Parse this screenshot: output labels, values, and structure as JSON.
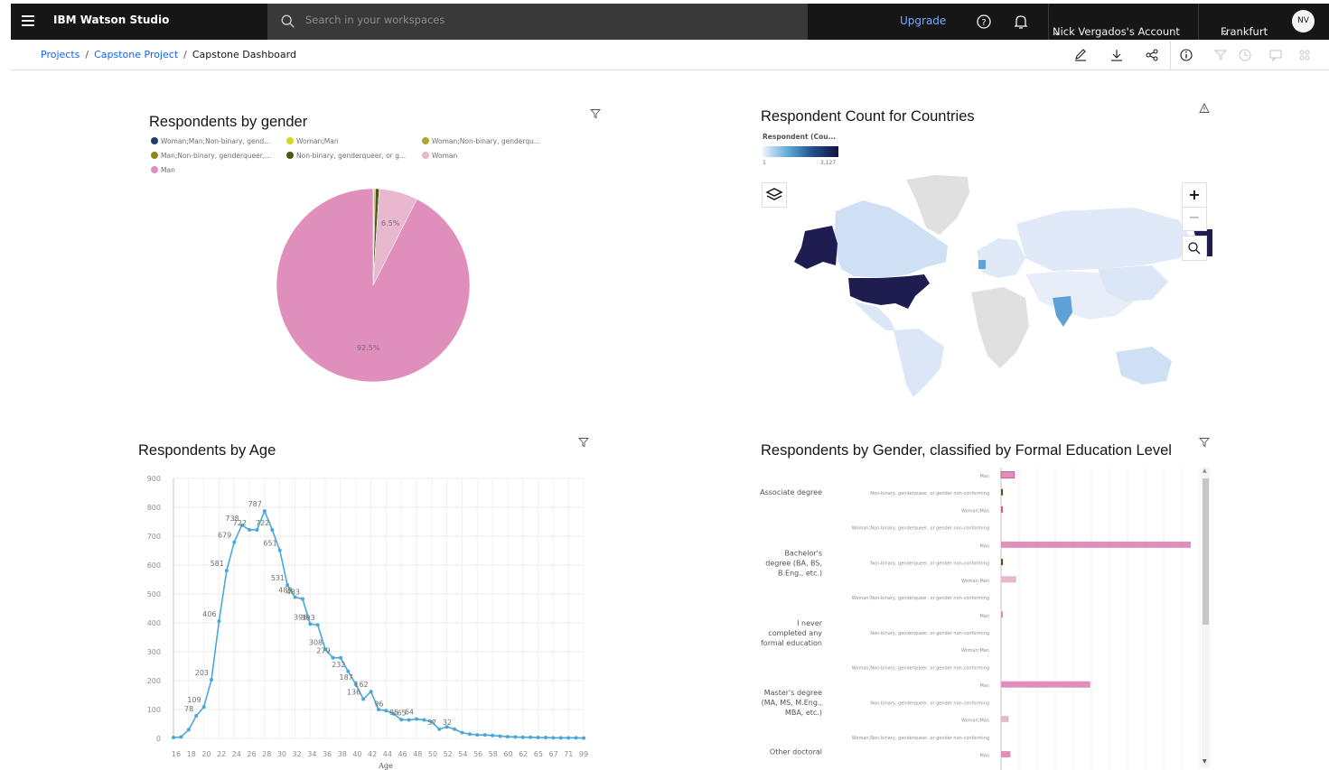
{
  "header": {
    "app_name": "IBM Watson Studio",
    "search_placeholder": "Search in your workspaces",
    "upgrade_label": "Upgrade",
    "account_label": "Nick Vergados's Account",
    "region_label": "Frankfurt",
    "avatar_initials": "NV"
  },
  "breadcrumb": {
    "items": [
      "Projects",
      "Capstone Project"
    ],
    "current": "Capstone Dashboard",
    "separator": "/"
  },
  "cards": {
    "gender": {
      "title": "Respondents by gender",
      "legend": [
        {
          "label": "Woman;Man;Non-binary, gend...",
          "color": "#1f3b73"
        },
        {
          "label": "Woman;Man",
          "color": "#d6d61f"
        },
        {
          "label": "Woman;Non-binary, genderqu...",
          "color": "#a8a832"
        },
        {
          "label": "Man;Non-binary, genderqueer,...",
          "color": "#8a8a1c"
        },
        {
          "label": "Non-binary, genderqueer, or g...",
          "color": "#4a5a12"
        },
        {
          "label": "Woman",
          "color": "#e8b8cf"
        },
        {
          "label": "Man",
          "color": "#e08fbd"
        }
      ],
      "slice_labels": {
        "man": "92.5%",
        "woman": "6.5%"
      }
    },
    "countries": {
      "title": "Respondent Count for Countries",
      "legend_title": "Respondent (Cou...",
      "legend_min": "1",
      "legend_max": "3,127"
    },
    "age": {
      "title": "Respondents by Age",
      "xlabel": "Age"
    },
    "education": {
      "title": "Respondents by Gender, classified by Formal Education Level",
      "groups": [
        {
          "label": "Associate degree",
          "rows": [
            "Man",
            "Non-binary, genderqueer, or gender non-conforming",
            "Woman;Man",
            "Woman;Non-binary, genderqueer, or gender non-conforming"
          ]
        },
        {
          "label": "Bachelor's degree (BA, BS, B.Eng., etc.)",
          "rows": [
            "Man",
            "Non-binary, genderqueer, or gender non-conforming",
            "Woman;Man",
            "Woman;Non-binary, genderqueer, or gender non-conforming"
          ]
        },
        {
          "label": "I never completed any formal education",
          "rows": [
            "Man",
            "Non-binary, genderqueer, or gender non-conforming",
            "Woman;Man",
            "Woman;Non-binary, genderqueer, or gender non-conforming"
          ]
        },
        {
          "label": "Master's degree (MA, MS, M.Eng., MBA, etc.)",
          "rows": [
            "Man",
            "Non-binary, genderqueer, or gender non-conforming",
            "Woman;Man",
            "Woman;Non-binary, genderqueer, or gender non-conforming"
          ]
        },
        {
          "label": "Other doctoral",
          "rows": [
            "Man"
          ]
        }
      ]
    }
  },
  "colors": {
    "man": "#e08fbd",
    "woman": "#e8b8cf",
    "nonbinary": "#4a5a12",
    "line": "#4aa8d8",
    "map_dark": "#1f1d4f",
    "map_light": "#cfe0f4"
  },
  "chart_data": [
    {
      "type": "pie",
      "title": "Respondents by gender",
      "categories": [
        "Man",
        "Woman",
        "Non-binary, genderqueer, or g...",
        "Man;Non-binary, genderqueer,...",
        "Woman;Non-binary, genderqu...",
        "Woman;Man",
        "Woman;Man;Non-binary, gend..."
      ],
      "values": [
        92.5,
        6.5,
        0.6,
        0.2,
        0.1,
        0.05,
        0.05
      ],
      "data_labels": [
        "92.5%",
        "6.5%"
      ]
    },
    {
      "type": "line",
      "title": "Respondents by Age",
      "xlabel": "Age",
      "ylabel": "",
      "ylim": [
        0,
        900
      ],
      "yticks": [
        0,
        100,
        200,
        300,
        400,
        500,
        600,
        700,
        800,
        900
      ],
      "x": [
        16,
        17,
        18,
        19,
        20,
        21,
        22,
        23,
        24,
        25,
        26,
        27,
        28,
        29,
        30,
        31,
        32,
        33,
        34,
        35,
        36,
        37,
        38,
        39,
        40,
        41,
        42,
        43,
        44,
        45,
        46,
        47,
        48,
        49,
        50,
        51,
        52,
        53,
        54,
        55,
        56,
        57,
        58,
        59,
        60,
        61,
        62,
        63,
        65,
        66,
        67,
        69,
        71,
        72,
        99
      ],
      "values": [
        3,
        5,
        30,
        78,
        109,
        203,
        406,
        581,
        679,
        738,
        722,
        722,
        787,
        722,
        651,
        531,
        489,
        483,
        396,
        393,
        308,
        279,
        279,
        232,
        187,
        136,
        162,
        100,
        96,
        85,
        65,
        64,
        67,
        64,
        57,
        32,
        40,
        32,
        20,
        15,
        12,
        12,
        10,
        8,
        6,
        5,
        4,
        4,
        3,
        3,
        2,
        2,
        2,
        2,
        1
      ],
      "data_labels": [
        {
          "x": 19,
          "label": "78"
        },
        {
          "x": 20,
          "label": "109"
        },
        {
          "x": 21,
          "label": "203"
        },
        {
          "x": 22,
          "label": "406"
        },
        {
          "x": 23,
          "label": "581"
        },
        {
          "x": 24,
          "label": "679"
        },
        {
          "x": 25,
          "label": "738"
        },
        {
          "x": 26,
          "label": "722"
        },
        {
          "x": 28,
          "label": "787"
        },
        {
          "x": 29,
          "label": "722"
        },
        {
          "x": 30,
          "label": "651"
        },
        {
          "x": 31,
          "label": "531"
        },
        {
          "x": 32,
          "label": "489"
        },
        {
          "x": 33,
          "label": "483"
        },
        {
          "x": 34,
          "label": "396"
        },
        {
          "x": 35,
          "label": "393"
        },
        {
          "x": 36,
          "label": "308"
        },
        {
          "x": 37,
          "label": "279"
        },
        {
          "x": 39,
          "label": "232"
        },
        {
          "x": 40,
          "label": "187"
        },
        {
          "x": 41,
          "label": "136"
        },
        {
          "x": 42,
          "label": "162"
        },
        {
          "x": 44,
          "label": "96"
        },
        {
          "x": 46,
          "label": "85"
        },
        {
          "x": 47,
          "label": "65"
        },
        {
          "x": 48,
          "label": "64"
        },
        {
          "x": 51,
          "label": "57"
        },
        {
          "x": 53,
          "label": "32"
        }
      ],
      "xtick_labels": [
        "16",
        "18",
        "20",
        "22",
        "24",
        "26",
        "28",
        "30",
        "32",
        "34",
        "36",
        "38",
        "40",
        "42",
        "44",
        "46",
        "48",
        "50",
        "52",
        "54",
        "56",
        "58",
        "60",
        "62",
        "65",
        "67",
        "71",
        "99"
      ]
    },
    {
      "type": "bar",
      "orientation": "horizontal",
      "title": "Respondents by Gender, classified by Formal Education Level",
      "series_note": "values as fraction of largest bar",
      "categories": [
        "Associate degree / Man",
        "Associate degree / Non-binary",
        "Associate degree / Woman;Man",
        "Bachelor's degree / Man",
        "Bachelor's degree / Non-binary",
        "Bachelor's degree / Woman",
        "I never completed any formal education / Man",
        "Master's degree / Man",
        "Master's degree / Woman",
        "Other doctoral / Man"
      ],
      "values": [
        0.07,
        0.01,
        0.01,
        1.0,
        0.01,
        0.08,
        0.01,
        0.47,
        0.04,
        0.05
      ]
    }
  ]
}
